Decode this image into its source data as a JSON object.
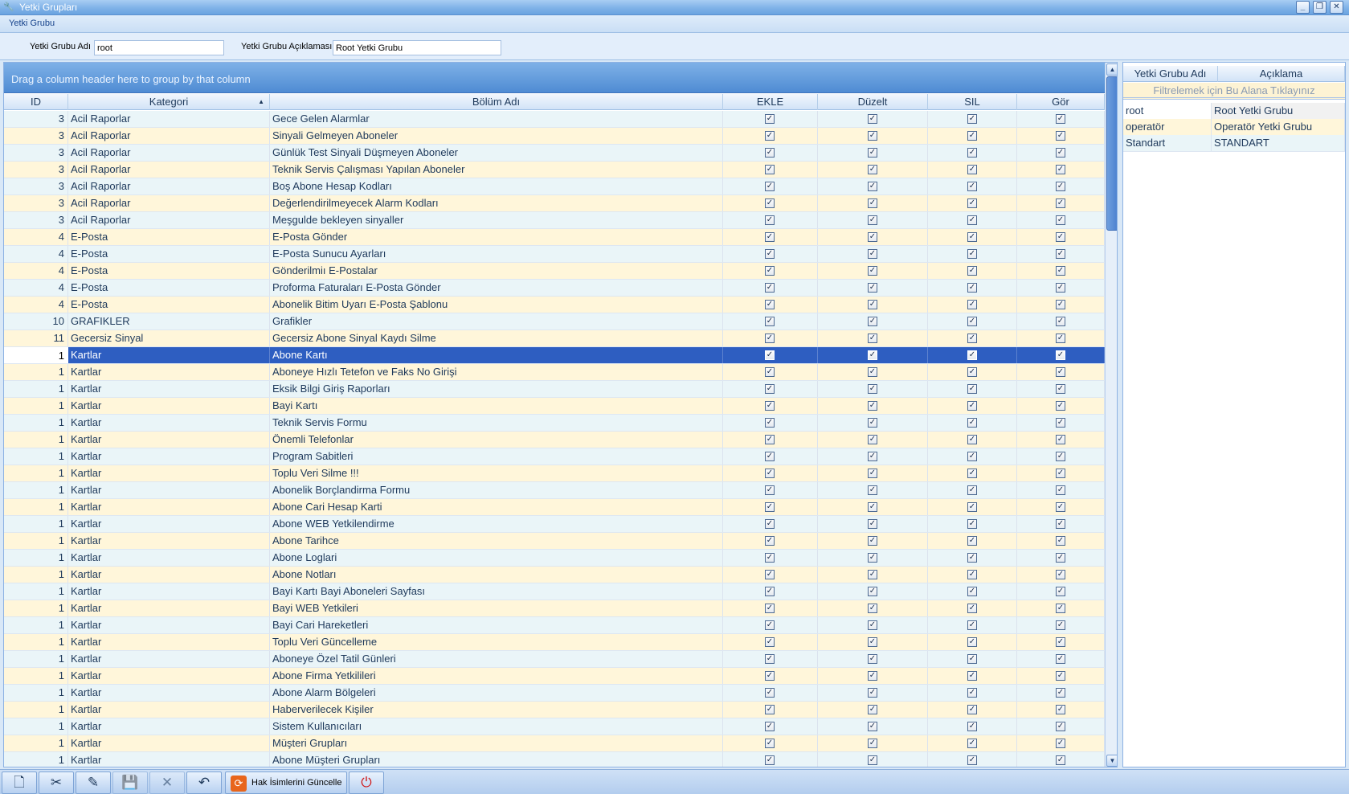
{
  "window": {
    "title": "Yetki Grupları",
    "minimize_glyph": "_",
    "restore_glyph": "❐",
    "close_glyph": "✕"
  },
  "menu": {
    "label": "Yetki Grubu"
  },
  "form": {
    "name_label": "Yetki Grubu Adı",
    "name_value": "root",
    "desc_label": "Yetki Grubu Açıklaması",
    "desc_value": "Root Yetki Grubu"
  },
  "grid": {
    "group_hint": "Drag a column header here to group by that column",
    "columns": [
      "ID",
      "Kategori",
      "Bölüm Adı",
      "EKLE",
      "Düzelt",
      "SIL",
      "Gör"
    ],
    "sorted_column": "Kategori",
    "selected_row_index": 14,
    "rows": [
      {
        "id": "3",
        "kategori": "Acil Raporlar",
        "bolum": "Gece Gelen Alarmlar"
      },
      {
        "id": "3",
        "kategori": "Acil Raporlar",
        "bolum": "Sinyali Gelmeyen Aboneler"
      },
      {
        "id": "3",
        "kategori": "Acil Raporlar",
        "bolum": "Günlük Test Sinyali Düşmeyen Aboneler"
      },
      {
        "id": "3",
        "kategori": "Acil Raporlar",
        "bolum": "Teknik Servis Çalışması Yapılan Aboneler"
      },
      {
        "id": "3",
        "kategori": "Acil Raporlar",
        "bolum": "Boş Abone Hesap Kodları"
      },
      {
        "id": "3",
        "kategori": "Acil Raporlar",
        "bolum": "Değerlendirilmeyecek Alarm Kodları"
      },
      {
        "id": "3",
        "kategori": "Acil Raporlar",
        "bolum": "Meşgulde bekleyen sinyaller"
      },
      {
        "id": "4",
        "kategori": "E-Posta",
        "bolum": "E-Posta Gönder"
      },
      {
        "id": "4",
        "kategori": "E-Posta",
        "bolum": "E-Posta Sunucu Ayarları"
      },
      {
        "id": "4",
        "kategori": "E-Posta",
        "bolum": "Gönderilmiı E-Postalar"
      },
      {
        "id": "4",
        "kategori": "E-Posta",
        "bolum": "Proforma Faturaları E-Posta Gönder"
      },
      {
        "id": "4",
        "kategori": "E-Posta",
        "bolum": "Abonelik Bitim Uyarı E-Posta Şablonu"
      },
      {
        "id": "10",
        "kategori": "GRAFIKLER",
        "bolum": "Grafikler"
      },
      {
        "id": "11",
        "kategori": "Gecersiz Sinyal",
        "bolum": "Gecersiz Abone Sinyal Kaydı Silme"
      },
      {
        "id": "1",
        "kategori": "Kartlar",
        "bolum": "Abone Kartı"
      },
      {
        "id": "1",
        "kategori": "Kartlar",
        "bolum": "Aboneye Hızlı Tetefon ve Faks No Girişi"
      },
      {
        "id": "1",
        "kategori": "Kartlar",
        "bolum": "Eksik Bilgi Giriş Raporları"
      },
      {
        "id": "1",
        "kategori": "Kartlar",
        "bolum": "Bayi Kartı"
      },
      {
        "id": "1",
        "kategori": "Kartlar",
        "bolum": "Teknik Servis Formu"
      },
      {
        "id": "1",
        "kategori": "Kartlar",
        "bolum": "Önemli Telefonlar"
      },
      {
        "id": "1",
        "kategori": "Kartlar",
        "bolum": "Program Sabitleri"
      },
      {
        "id": "1",
        "kategori": "Kartlar",
        "bolum": "Toplu Veri Silme !!!"
      },
      {
        "id": "1",
        "kategori": "Kartlar",
        "bolum": "Abonelik Borçlandirma Formu"
      },
      {
        "id": "1",
        "kategori": "Kartlar",
        "bolum": "Abone Cari Hesap Karti"
      },
      {
        "id": "1",
        "kategori": "Kartlar",
        "bolum": "Abone WEB Yetkilendirme"
      },
      {
        "id": "1",
        "kategori": "Kartlar",
        "bolum": "Abone Tarihce"
      },
      {
        "id": "1",
        "kategori": "Kartlar",
        "bolum": "Abone Loglari"
      },
      {
        "id": "1",
        "kategori": "Kartlar",
        "bolum": "Abone Notları"
      },
      {
        "id": "1",
        "kategori": "Kartlar",
        "bolum": "Bayi Kartı Bayi Aboneleri Sayfası"
      },
      {
        "id": "1",
        "kategori": "Kartlar",
        "bolum": "Bayi WEB Yetkileri"
      },
      {
        "id": "1",
        "kategori": "Kartlar",
        "bolum": "Bayi Cari Hareketleri"
      },
      {
        "id": "1",
        "kategori": "Kartlar",
        "bolum": "Toplu Veri Güncelleme"
      },
      {
        "id": "1",
        "kategori": "Kartlar",
        "bolum": "Aboneye Özel Tatil Günleri"
      },
      {
        "id": "1",
        "kategori": "Kartlar",
        "bolum": "Abone Firma Yetkilileri"
      },
      {
        "id": "1",
        "kategori": "Kartlar",
        "bolum": "Abone Alarm Bölgeleri"
      },
      {
        "id": "1",
        "kategori": "Kartlar",
        "bolum": "Haberverilecek Kişiler"
      },
      {
        "id": "1",
        "kategori": "Kartlar",
        "bolum": "Sistem Kullanıcıları"
      },
      {
        "id": "1",
        "kategori": "Kartlar",
        "bolum": "Müşteri Grupları"
      },
      {
        "id": "1",
        "kategori": "Kartlar",
        "bolum": "Abone Müşteri Grupları"
      }
    ],
    "check_glyph": "✓",
    "scroll_up_glyph": "▲",
    "scroll_down_glyph": "▼",
    "sort_glyph": "▲"
  },
  "right_panel": {
    "columns": [
      "Yetki Grubu Adı",
      "Açıklama"
    ],
    "filter_hint": "Filtrelemek için Bu Alana Tıklayınız",
    "rows": [
      {
        "name": "root",
        "desc": "Root Yetki Grubu"
      },
      {
        "name": "operatör",
        "desc": "Operatör Yetki Grubu"
      },
      {
        "name": "Standart",
        "desc": "STANDART"
      }
    ]
  },
  "toolbar": {
    "new_glyph": "🗋",
    "cut_glyph": "✂",
    "edit_glyph": "✎",
    "save_glyph": "💾",
    "cancel_glyph": "✕",
    "undo_glyph": "↶",
    "refresh_label": "Hak İsimlerini Güncelle",
    "refresh_glyph": "⟳",
    "power_glyph": "⏻"
  },
  "colors": {
    "selected_row": "#2e5ec1",
    "row_even": "#eaf5f8",
    "row_odd": "#fff6da",
    "group_band": "#4f8bd3"
  }
}
